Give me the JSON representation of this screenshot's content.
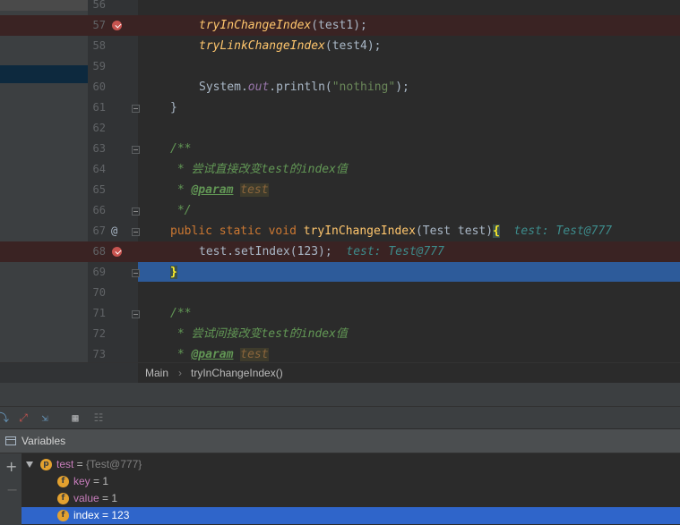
{
  "editor": {
    "lines": [
      {
        "n": "56"
      },
      {
        "n": "57",
        "call1": "tryInChangeIndex",
        "arg1": "(test1);"
      },
      {
        "n": "58",
        "call2": "tryLinkChangeIndex",
        "arg2": "(test4);"
      },
      {
        "n": "59"
      },
      {
        "n": "60",
        "p1": "System.",
        "p2": "out",
        "p3": ".println(",
        "p4": "\"nothing\"",
        "p5": ");"
      },
      {
        "n": "61",
        "code": "}"
      },
      {
        "n": "62"
      },
      {
        "n": "63",
        "code": "/**"
      },
      {
        "n": "64",
        "star": " * ",
        "text": "尝试直接改变test的index值"
      },
      {
        "n": "65",
        "star": " * ",
        "tag": "@param",
        "ref": "test"
      },
      {
        "n": "66",
        "code": " */"
      },
      {
        "n": "67",
        "kw1": "public",
        "kw2": "static",
        "kw3": "void",
        "method": "tryInChangeIndex",
        "params": "(Test test)",
        "brace": "{",
        "hint": "test: Test@777"
      },
      {
        "n": "68",
        "stmt": "test.setIndex(123);",
        "hint": "test: Test@777"
      },
      {
        "n": "69",
        "brace": "}"
      },
      {
        "n": "70"
      },
      {
        "n": "71",
        "code": "/**"
      },
      {
        "n": "72",
        "star": " * ",
        "text": "尝试间接改变test的index值"
      },
      {
        "n": "73",
        "star": " * ",
        "tag": "@param",
        "ref": "test"
      }
    ]
  },
  "breadcrumb": {
    "items": [
      "Main",
      "tryInChangeIndex()"
    ]
  },
  "variables_panel": {
    "title": "Variables",
    "rows": [
      {
        "badge": "p",
        "name": "test",
        "eq": " = ",
        "value": "{Test@777}"
      },
      {
        "badge": "f",
        "name": "key",
        "eq": " = ",
        "value": "1"
      },
      {
        "badge": "f",
        "name": "value",
        "eq": " = ",
        "value": "1"
      },
      {
        "badge": "f",
        "name": "index",
        "eq": " = ",
        "value": "123"
      }
    ]
  },
  "colors": {
    "breakpoint": "#c75450",
    "execution_line": "#2d5b9a",
    "selected_row": "#2f65ca"
  }
}
